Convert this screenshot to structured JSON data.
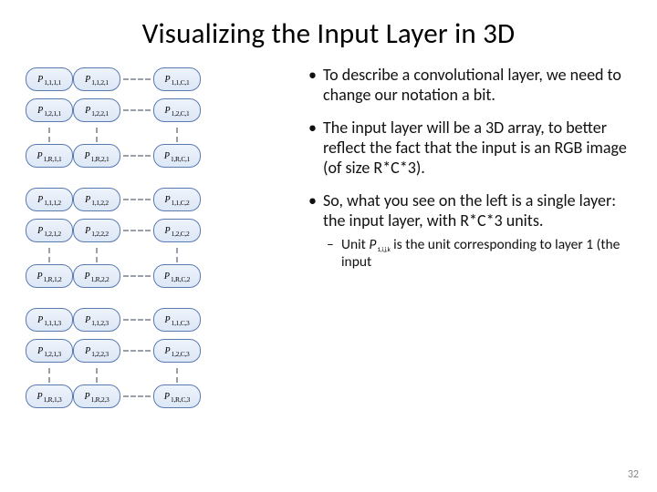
{
  "title": "Visualizing the Input Layer in 3D",
  "page_number": "32",
  "bullets": [
    "To describe a convolutional layer, we need to change our notation a bit.",
    "The input layer will be a 3D array, to better reflect the fact that the input is an RGB image (of size R*C*3).",
    "So, what you see on the left is a single layer: the input layer, with R*C*3 units."
  ],
  "sub_bullet_prefix": "Unit ",
  "sub_bullet_unit_symbol": "P",
  "sub_bullet_unit_sub": "1,i,j,k",
  "sub_bullet_suffix": " is the unit corresponding to layer 1 (the input",
  "node_symbol": "P",
  "planes": [
    {
      "k": "1",
      "rows": [
        [
          "1,1,1,1",
          "1,1,2,1",
          "1,1,C,1"
        ],
        [
          "1,2,1,1",
          "1,2,2,1",
          "1,2,C,1"
        ],
        [
          "1,R,1,1",
          "1,R,2,1",
          "1,R,C,1"
        ]
      ]
    },
    {
      "k": "2",
      "rows": [
        [
          "1,1,1,2",
          "1,1,2,2",
          "1,1,C,2"
        ],
        [
          "1,2,1,2",
          "1,2,2,2",
          "1,2,C,2"
        ],
        [
          "1,R,1,2",
          "1,R,2,2",
          "1,R,C,2"
        ]
      ]
    },
    {
      "k": "3",
      "rows": [
        [
          "1,1,1,3",
          "1,1,2,3",
          "1,1,C,3"
        ],
        [
          "1,2,1,3",
          "1,2,2,3",
          "1,2,C,3"
        ],
        [
          "1,R,1,3",
          "1,R,2,3",
          "1,R,C,3"
        ]
      ]
    }
  ]
}
